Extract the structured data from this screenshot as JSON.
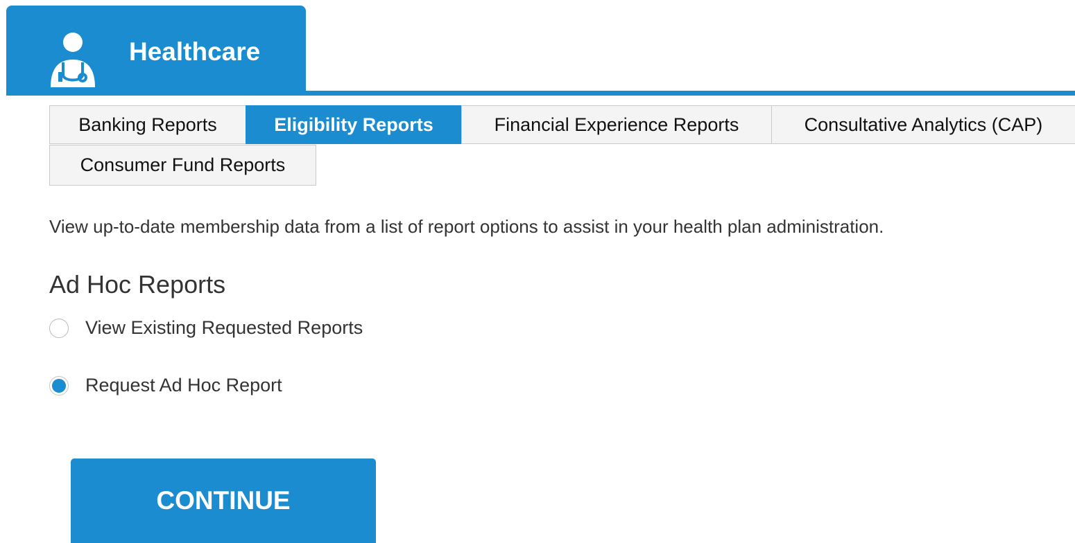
{
  "app": {
    "title": "Healthcare",
    "icon": "doctor-icon",
    "accent_color": "#1b8ccf"
  },
  "report_tabs": [
    {
      "label": "Banking Reports",
      "active": false
    },
    {
      "label": "Eligibility Reports",
      "active": true
    },
    {
      "label": "Financial Experience Reports",
      "active": false
    },
    {
      "label": "Consultative Analytics (CAP)",
      "active": false
    },
    {
      "label": "Consumer Fund Reports",
      "active": false
    }
  ],
  "intro_text": "View up-to-date membership data from a list of report options to assist in your health plan administration.",
  "ad_hoc": {
    "title": "Ad Hoc Reports",
    "options": [
      {
        "label": "View Existing Requested Reports",
        "selected": false
      },
      {
        "label": "Request Ad Hoc Report",
        "selected": true
      }
    ]
  },
  "continue_label": "CONTINUE"
}
